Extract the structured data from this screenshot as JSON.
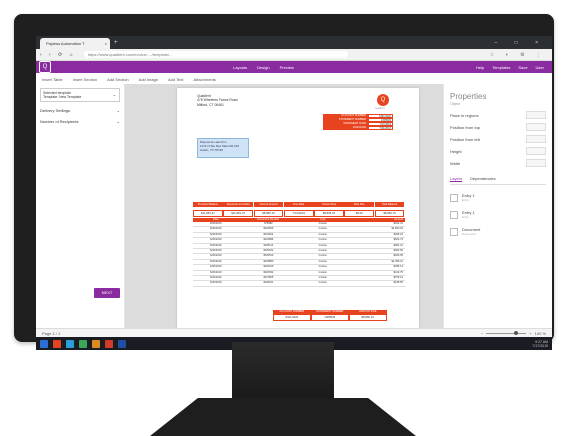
{
  "browser": {
    "tab_title": "Payless Automation T",
    "url": "https://www.quadient.com/evolve/..../template/...",
    "nav_icons": "‹ › ⟳ ⌂",
    "ext_icons": "☆ ◐ ⚙ ⋮",
    "win_controls": "– □ ×"
  },
  "app_header": {
    "logo": "Q",
    "center_items": [
      "Layouts",
      "Design",
      "Preview"
    ],
    "right_items": [
      "Help",
      "Templates",
      "Save",
      "User"
    ]
  },
  "toolbar": {
    "items": [
      "Insert Table",
      "Insert Section",
      "Add Section",
      "Add Image",
      "Add Text",
      "Attachments"
    ]
  },
  "left_pane": {
    "select_label": "Selected template",
    "select_value": "Template: New Template",
    "accordions": [
      "Delivery Settings",
      "Number of Recipients"
    ],
    "next_button": "NEXT"
  },
  "document": {
    "sender_address": [
      "Quadient",
      "478 Wheelers Farms Road",
      "Milford, CT 06461"
    ],
    "logo_letter": "Q",
    "logo_caption": "quadient",
    "summary_box": [
      {
        "k": "ACCOUNT NUMBER",
        "v": "SSD-0422"
      },
      {
        "k": "STATEMENT NUMBER",
        "v": "1005529"
      },
      {
        "k": "STATEMENT DATE",
        "v": "7/17/2019"
      },
      {
        "k": "DUE DATE",
        "v": "7/31/2019"
      }
    ],
    "remit_to": [
      "Payments Law Firm",
      "1271 N Ste Des Main Rd 100",
      "Austin, TX 78746"
    ],
    "summary_headers": [
      "Previous Balance",
      "Payments & Credits",
      "Current Amount",
      "Due Date",
      "Current Due",
      "Past Due",
      "Total Balance"
    ],
    "summary_values": [
      "$11,881.37",
      "$11,881.37",
      "$8,866.15",
      "7/31/2019",
      "$8,866.15",
      "$0.00",
      "$8,866.15"
    ],
    "transactions_headers": [
      "Date",
      "Document Number",
      "Type",
      "Amount"
    ],
    "transactions": [
      [
        "6/30/2019",
        "975982",
        "Invoice",
        "$322.31"
      ],
      [
        "6/30/2019",
        "3022565",
        "Invoice",
        "$1,832.15"
      ],
      [
        "6/30/2019",
        "3024814",
        "Invoice",
        "$295.22"
      ],
      [
        "6/30/2019",
        "3024986",
        "Invoice",
        "$623.73"
      ],
      [
        "6/30/2019",
        "3025112",
        "Invoice",
        "$481.21"
      ],
      [
        "6/30/2019",
        "3025431",
        "Invoice",
        "$302.56"
      ],
      [
        "6/30/2019",
        "3025510",
        "Invoice",
        "$326.05"
      ],
      [
        "6/30/2019",
        "3025880",
        "Invoice",
        "$1,355.21"
      ],
      [
        "6/30/2019",
        "3026019",
        "Invoice",
        "$396.13"
      ],
      [
        "6/30/2019",
        "3026392",
        "Invoice",
        "$413.75"
      ],
      [
        "6/30/2019",
        "3027865",
        "Invoice",
        "$705.12"
      ],
      [
        "6/30/2019",
        "3028441",
        "Invoice",
        "$448.55"
      ]
    ],
    "footer_headers": [
      "ACCOUNT NUMBER",
      "STATEMENT NUMBER",
      "AMOUNT DUE"
    ],
    "footer_values": [
      "SSD-0422",
      "1005529",
      "$8,866.15"
    ]
  },
  "right_pane": {
    "title": "Properties",
    "subtitle": "Object",
    "rows": [
      "Place in regions",
      "Position from top",
      "Position from left",
      "Height",
      "Width"
    ],
    "tabs": [
      "Layers",
      "Dependencies"
    ],
    "layers": [
      {
        "name": "Entry 1",
        "sub": "Entry"
      },
      {
        "name": "Entry 1",
        "sub": "Entry"
      },
      {
        "name": "Document",
        "sub": "Document"
      }
    ]
  },
  "statusbar": {
    "page_label": "Page",
    "page_value": "1 / 1",
    "zoom": "100 %"
  },
  "taskbar": {
    "time": "9:27 AM",
    "date": "7/17/2019",
    "colors": [
      "#2b6fd6",
      "#e8431f",
      "#2aa0d8",
      "#3aa757",
      "#e08a1e",
      "#d23a2a",
      "#1f4fa0"
    ]
  }
}
